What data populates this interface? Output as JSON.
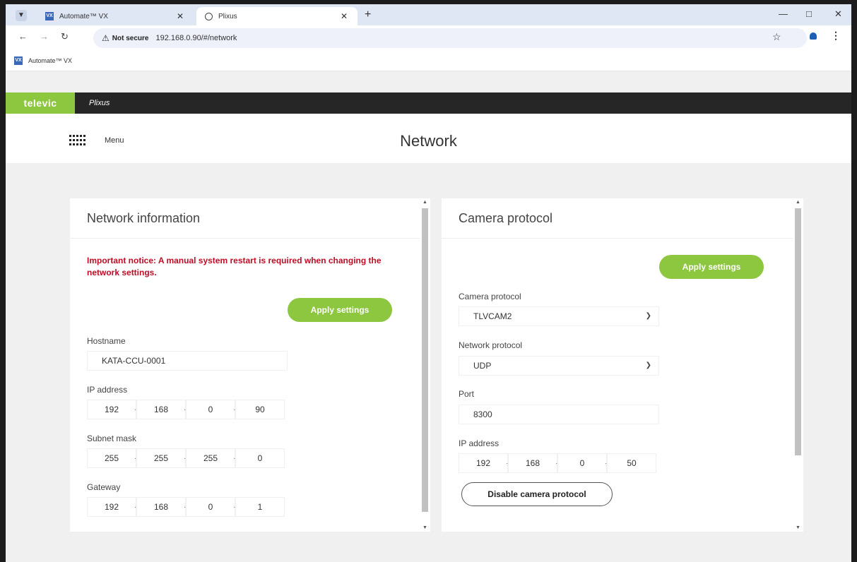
{
  "browser": {
    "tabs": [
      {
        "title": "Automate™ VX"
      },
      {
        "title": "Plixus"
      }
    ],
    "new_tab_icon": "+",
    "address": {
      "security_label": "Not secure",
      "url": "192.168.0.90/#/network"
    },
    "bookmarks": [
      {
        "label": "Automate™ VX"
      }
    ]
  },
  "app": {
    "brand": "televic",
    "product": "Plixus",
    "menu_label": "Menu",
    "page_title": "Network",
    "colors": {
      "brand_green": "#8dc63f",
      "notice_red": "#c00c25",
      "header_dark": "#262626"
    }
  },
  "network_information": {
    "title": "Network information",
    "notice": "Important notice: A manual system restart is required when changing the network settings.",
    "apply_label": "Apply settings",
    "hostname_label": "Hostname",
    "hostname": "KATA-CCU-0001",
    "ip_label": "IP address",
    "ip": [
      "192",
      "168",
      "0",
      "90"
    ],
    "subnet_label": "Subnet mask",
    "subnet": [
      "255",
      "255",
      "255",
      "0"
    ],
    "gateway_label": "Gateway",
    "gateway": [
      "192",
      "168",
      "0",
      "1"
    ]
  },
  "camera_protocol": {
    "title": "Camera protocol",
    "apply_label": "Apply settings",
    "camera_protocol_label": "Camera protocol",
    "camera_protocol_value": "TLVCAM2",
    "network_protocol_label": "Network protocol",
    "network_protocol_value": "UDP",
    "port_label": "Port",
    "port": "8300",
    "ip_label": "IP address",
    "ip": [
      "192",
      "168",
      "0",
      "50"
    ],
    "disable_label": "Disable camera protocol"
  }
}
